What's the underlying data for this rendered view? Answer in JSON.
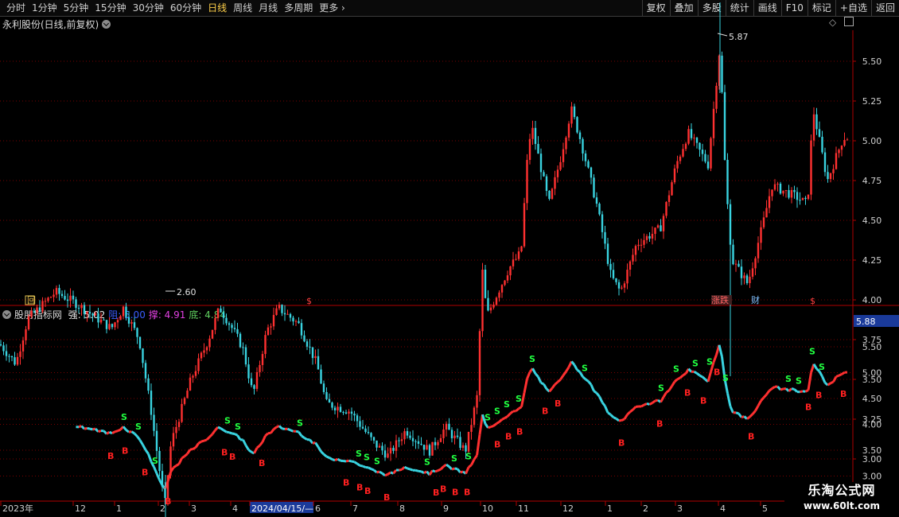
{
  "toolbar": {
    "periods": [
      "分时",
      "1分钟",
      "5分钟",
      "15分钟",
      "30分钟",
      "60分钟",
      "日线",
      "周线",
      "月线",
      "多周期",
      "更多"
    ],
    "active_period": "日线",
    "more_chevron": "›",
    "buttons": [
      "复权",
      "叠加",
      "多股",
      "统计",
      "画线",
      "F10",
      "标记",
      "+自选",
      "返回"
    ]
  },
  "main_panel": {
    "title": "永利股份(日线,前复权)",
    "y_ticks": [
      "5.50",
      "5.25",
      "5.00",
      "4.75",
      "4.50",
      "4.25",
      "4.00",
      "3.75",
      "3.50",
      "3.25",
      "3.00"
    ],
    "high_label": "5.87",
    "low_label": "2.60",
    "markers": {
      "s1": "$",
      "s2": "$",
      "zhangdie": "涨跌",
      "cai": "财",
      "hui": "回"
    }
  },
  "indicator_panel": {
    "name": "股朋指标网",
    "values": [
      {
        "label": "强:",
        "value": "5.02",
        "color": "#e8e8e8"
      },
      {
        "label": "阻:",
        "value": "5.00",
        "color": "#3a5cff"
      },
      {
        "label": "撑:",
        "value": "4.91",
        "color": "#e040e0"
      },
      {
        "label": "底:",
        "value": "4.84",
        "color": "#60d060"
      }
    ],
    "current_value": "5.88",
    "y_ticks": [
      "5.50",
      "5.00",
      "4.50",
      "4.00",
      "3.50",
      "3.00"
    ],
    "signal_buy": "B",
    "signal_sell": "S"
  },
  "time_axis": {
    "labels": [
      "2023年",
      "12",
      "1",
      "2",
      "3",
      "4",
      "2024/04/15/—",
      "6",
      "7",
      "8",
      "9",
      "10",
      "11",
      "12",
      "1",
      "2",
      "3",
      "4",
      "5"
    ]
  },
  "watermark": {
    "line1": "乐淘公式网",
    "line2": "www.60lt.com"
  },
  "colors": {
    "up": "#ff3030",
    "down": "#39d3e0",
    "grid": "#7a0000",
    "axis": "#b00000",
    "buy": "#ff2020",
    "sell": "#20ff40"
  }
}
